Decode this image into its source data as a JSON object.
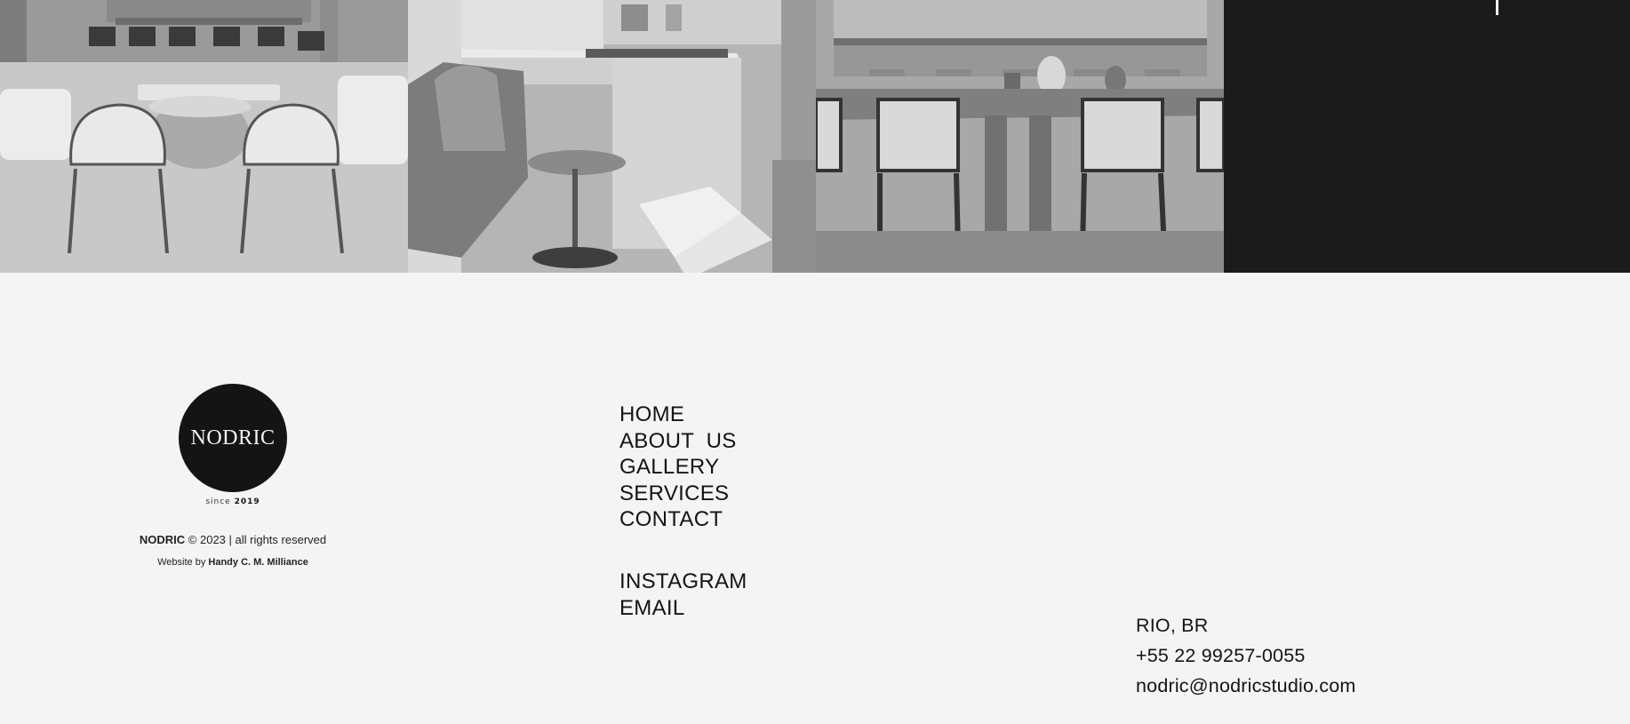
{
  "gallery": {
    "photos": [
      {
        "name": "living-room-photo"
      },
      {
        "name": "kitchen-island-photo"
      },
      {
        "name": "dining-table-photo"
      }
    ]
  },
  "brand": {
    "logo_text": "NODRIC",
    "since_label": "since",
    "since_year": "2019",
    "copyright_brand": "NODRIC",
    "copyright_rest": "© 2023 | all rights reserved",
    "credit_prefix": "Website by",
    "credit_name": "Handy C. M. Milliance"
  },
  "nav": {
    "items": [
      "HOME",
      "ABOUT  US",
      "GALLERY",
      "SERVICES",
      "CONTACT"
    ]
  },
  "social": {
    "items": [
      "INSTAGRAM",
      "EMAIL"
    ]
  },
  "contact": {
    "location": "RIO, BR",
    "phone": "+55 22 99257-0055",
    "email": "nodric@nodricstudio.com"
  },
  "colors": {
    "background": "#f4f4f4",
    "dark_panel": "#1b1b1b",
    "text": "#141414"
  }
}
